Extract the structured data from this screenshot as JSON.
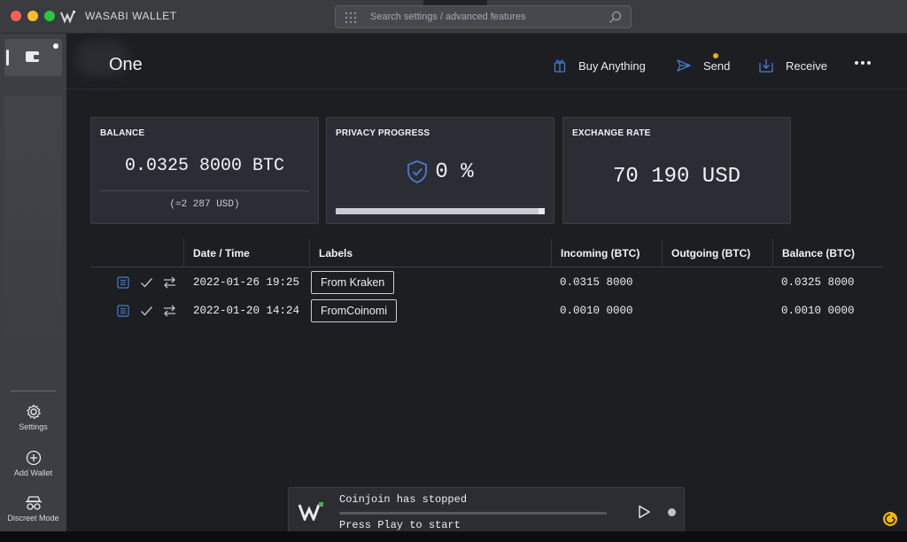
{
  "window": {
    "title": "WASABI WALLET"
  },
  "search": {
    "placeholder": "Search settings / advanced features"
  },
  "sidebar": {
    "settings_label": "Settings",
    "add_wallet_label": "Add Wallet",
    "discreet_label": "Discreet Mode"
  },
  "header": {
    "wallet_name": "One",
    "buy_label": "Buy Anything",
    "send_label": "Send",
    "receive_label": "Receive"
  },
  "balance": {
    "title": "BALANCE",
    "btc": "0.0325 8000 BTC",
    "usd": "(≈2 287 USD)"
  },
  "privacy": {
    "title": "PRIVACY PROGRESS",
    "percent": "0 %",
    "progress_fraction": 0
  },
  "rate": {
    "title": "EXCHANGE RATE",
    "value": "70 190 USD"
  },
  "table": {
    "headers": {
      "datetime": "Date / Time",
      "labels": "Labels",
      "incoming": "Incoming (BTC)",
      "outgoing": "Outgoing (BTC)",
      "balance": "Balance (BTC)"
    },
    "rows": [
      {
        "datetime": "2022-01-26 19:25",
        "label": "From Kraken",
        "incoming": "0.0315 8000",
        "outgoing": "",
        "balance": "0.0325 8000"
      },
      {
        "datetime": "2022-01-20 14:24",
        "label": "FromCoinomi",
        "incoming": "0.0010 0000",
        "outgoing": "",
        "balance": "0.0010 0000"
      }
    ]
  },
  "coinjoin": {
    "status": "Coinjoin has stopped",
    "hint": "Press Play to start",
    "progress_fraction": 0
  },
  "colors": {
    "accent_blue": "#4a7bd0",
    "notification": "#f5a623",
    "badge": "#f5b800"
  }
}
